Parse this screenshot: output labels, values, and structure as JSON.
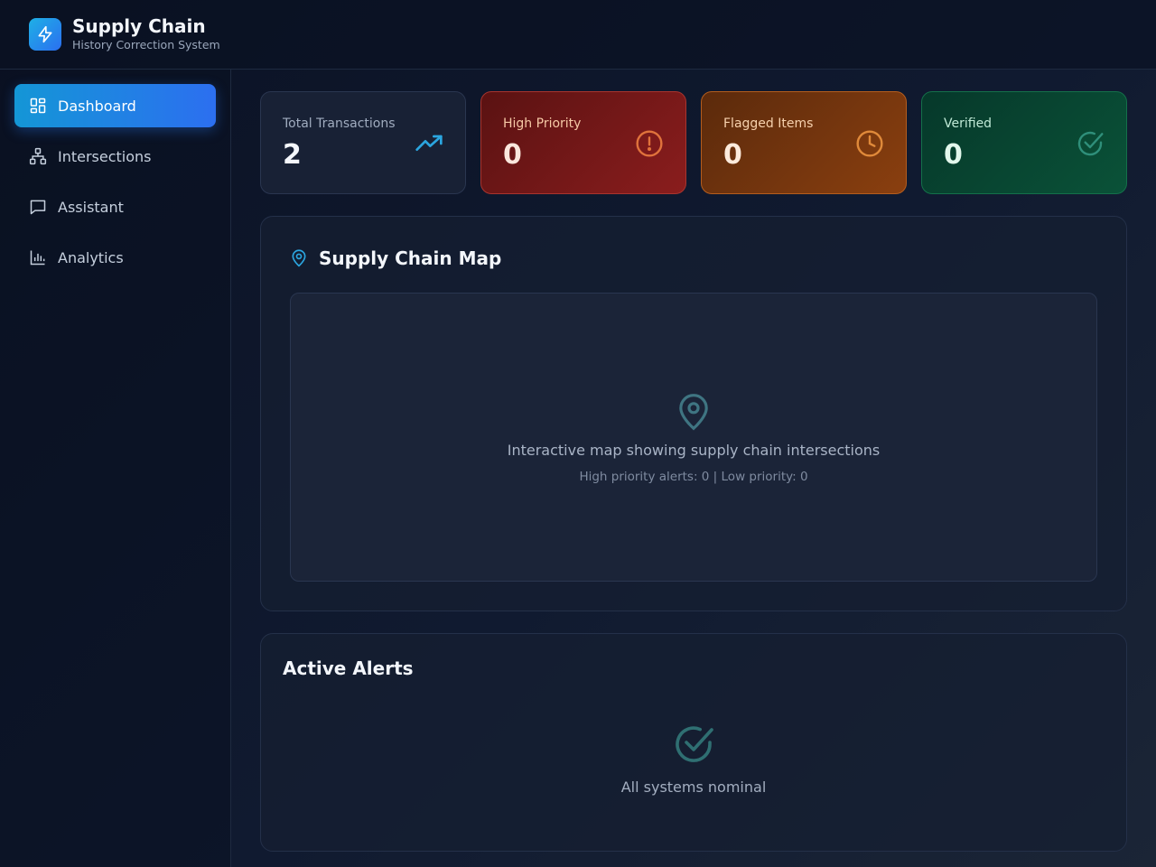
{
  "app": {
    "title": "Supply Chain",
    "subtitle": "History Correction System",
    "logo_icon": "lightning-icon"
  },
  "sidebar": {
    "items": [
      {
        "label": "Dashboard",
        "icon": "dashboard-grid-icon",
        "active": true
      },
      {
        "label": "Intersections",
        "icon": "network-icon",
        "active": false
      },
      {
        "label": "Assistant",
        "icon": "chat-bubble-icon",
        "active": false
      },
      {
        "label": "Analytics",
        "icon": "bar-chart-icon",
        "active": false
      }
    ]
  },
  "stats": [
    {
      "label": "Total Transactions",
      "value": "2",
      "icon": "trending-up-icon",
      "accent": "#2ba6e0"
    },
    {
      "label": "High Priority",
      "value": "0",
      "icon": "alert-circle-icon",
      "accent": "#e0733c"
    },
    {
      "label": "Flagged Items",
      "value": "0",
      "icon": "clock-icon",
      "accent": "#e08a3a"
    },
    {
      "label": "Verified",
      "value": "0",
      "icon": "check-circle-icon",
      "accent": "#2f8f7a"
    }
  ],
  "map_panel": {
    "title": "Supply Chain Map",
    "title_icon": "map-pin-icon",
    "placeholder_icon": "map-pin-icon",
    "description": "Interactive map showing supply chain intersections",
    "stats_line": "High priority alerts: 0 | Low priority: 0"
  },
  "alerts_panel": {
    "title": "Active Alerts",
    "empty_icon": "check-circle-icon",
    "empty_message": "All systems nominal"
  }
}
